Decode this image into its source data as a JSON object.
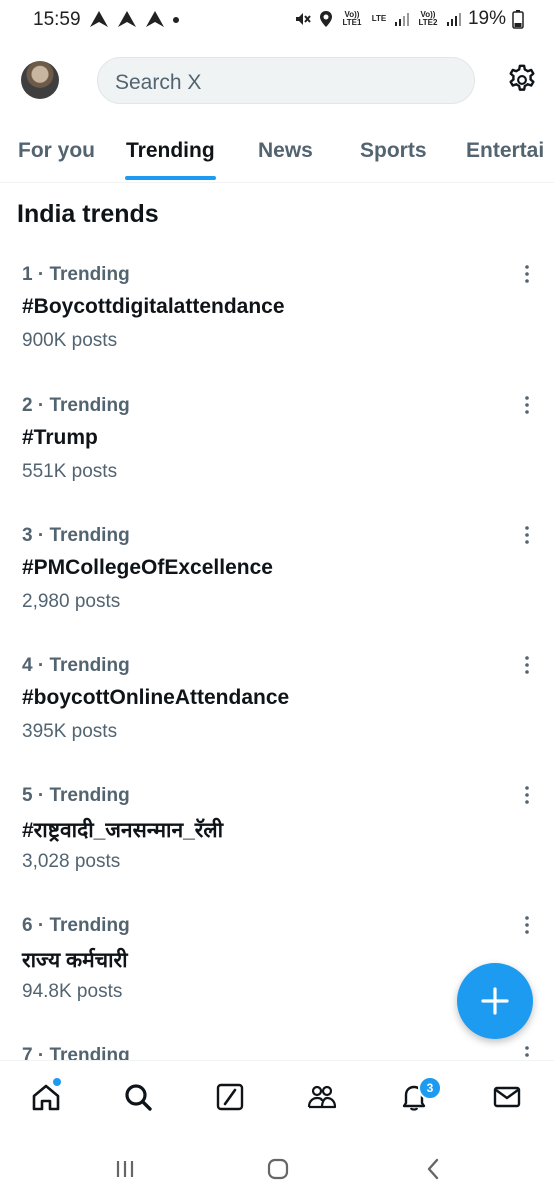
{
  "status_bar": {
    "time": "15:59",
    "network_left": "Vo)) LTE1",
    "lte": "LTE",
    "network_right": "Vo)) LTE2",
    "battery": "19%"
  },
  "header": {
    "search_placeholder": "Search X",
    "avatar_icon": "avatar",
    "settings_icon": "gear-icon"
  },
  "tabs": [
    {
      "label": "For you",
      "active": false
    },
    {
      "label": "Trending",
      "active": true
    },
    {
      "label": "News",
      "active": false
    },
    {
      "label": "Sports",
      "active": false
    },
    {
      "label": "Entertai",
      "active": false
    }
  ],
  "section_title": "India trends",
  "trends": [
    {
      "meta": "1 · Trending",
      "name": "#Boycottdigitalattendance",
      "count": "900K posts"
    },
    {
      "meta": "2 · Trending",
      "name": "#Trump",
      "count": "551K posts"
    },
    {
      "meta": "3 · Trending",
      "name": "#PMCollegeOfExcellence",
      "count": "2,980 posts"
    },
    {
      "meta": "4 · Trending",
      "name": "#boycottOnlineAttendance",
      "count": "395K posts"
    },
    {
      "meta": "5 · Trending",
      "name": "#राष्ट्रवादी_जनसन्मान_रॅली",
      "count": "3,028 posts"
    },
    {
      "meta": "6 · Trending",
      "name": "राज्य कर्मचारी",
      "count": "94.8K posts"
    },
    {
      "meta": "7 · Trending",
      "name": "",
      "count": ""
    }
  ],
  "fab": {
    "icon": "plus-icon"
  },
  "bottom_nav": {
    "items": [
      "home-icon",
      "search-icon",
      "grok-icon",
      "communities-icon",
      "notifications-icon",
      "messages-icon"
    ],
    "notification_badge": "3"
  },
  "colors": {
    "accent": "#1d9bf0",
    "text": "#0f1419",
    "muted": "#536471"
  }
}
